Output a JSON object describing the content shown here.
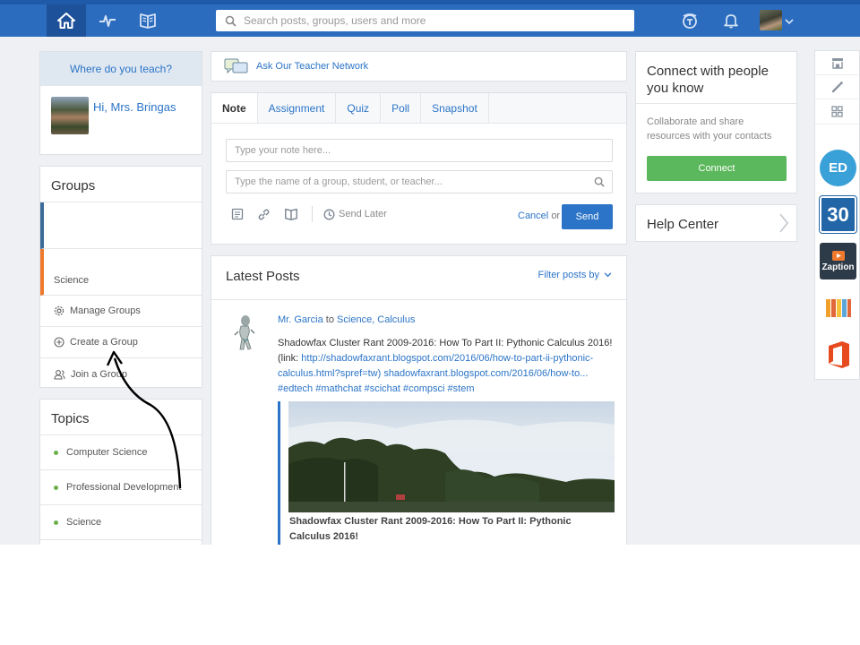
{
  "topbar": {
    "search_placeholder": "Search posts, groups, users and more"
  },
  "left": {
    "teach_prompt": "Where do you teach?",
    "greeting": "Hi, Mrs. Bringas",
    "groups_title": "Groups",
    "group_name": "Science",
    "menu": {
      "manage": "Manage Groups",
      "create": "Create a Group",
      "join": "Join a Group"
    },
    "topics_title": "Topics",
    "topics": [
      "Computer Science",
      "Professional Development",
      "Science"
    ]
  },
  "center": {
    "network_link": "Ask Our Teacher Network",
    "tabs": [
      "Note",
      "Assignment",
      "Quiz",
      "Poll",
      "Snapshot"
    ],
    "note_placeholder": "Type your note here...",
    "recipient_placeholder": "Type the name of a group, student, or teacher...",
    "send_later": "Send Later",
    "cancel": "Cancel",
    "or": "or",
    "send": "Send",
    "latest_title": "Latest Posts",
    "filter": "Filter posts by",
    "post": {
      "author": "Mr. Garcia",
      "to": "to",
      "groups": "Science, Calculus",
      "text": "Shadowfax Cluster Rant 2009-2016: How To Part II: Pythonic Calculus 2016! (link: ",
      "url1": "http://shadowfaxrant.blogspot.com/2016/06/how-to-part-ii-pythonic-calculus.html?spref=tw)",
      "url2": "shadowfaxrant.blogspot.com/2016/06/how-to...",
      "tags": "#edtech #mathchat #scichat #compsci #stem",
      "preview_title": "Shadowfax Cluster Rant 2009-2016: How To Part II: Pythonic Calculus 2016!"
    }
  },
  "right": {
    "connect_title": "Connect with people you know",
    "connect_desc": "Collaborate and share resources with your contacts",
    "connect_button": "Connect",
    "help_center": "Help Center"
  },
  "rail": {
    "apps": [
      "ED",
      "30",
      "Zaption"
    ]
  },
  "colors": {
    "nav": "#2b6cbf",
    "link": "#2b74c7",
    "connect": "#5cb85c",
    "group_blue": "#3c6c99",
    "group_orange": "#ef7a2e"
  }
}
